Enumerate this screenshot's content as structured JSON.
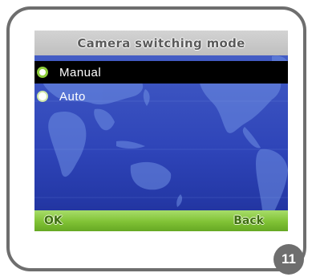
{
  "screen": {
    "title": "Camera switching mode",
    "options": [
      {
        "label": "Manual",
        "selected": true
      },
      {
        "label": "Auto",
        "selected": false
      }
    ],
    "softkeys": {
      "left": "OK",
      "right": "Back"
    }
  },
  "page": {
    "number": "11"
  },
  "colors": {
    "background_blue": "#3a52c0",
    "highlight": "#000000",
    "softkey_bar": "#80c235",
    "radio_accent": "#8dcc3a",
    "frame": "#6e6e6e"
  },
  "icons": {
    "selected_radio": "radio-checked-icon",
    "unselected_radio": "radio-unchecked-icon",
    "background": "world-map"
  }
}
